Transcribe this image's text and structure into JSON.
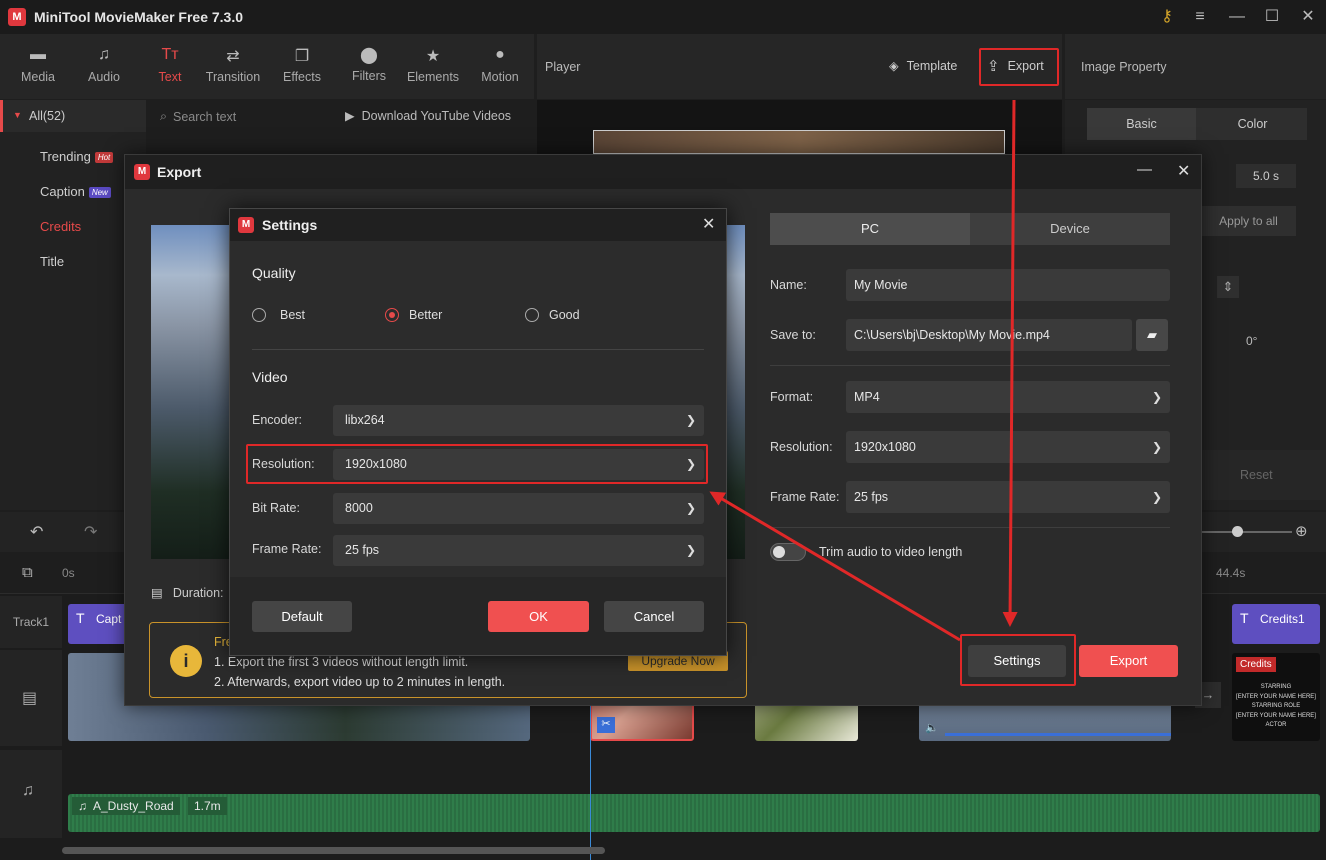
{
  "app": {
    "title": "MiniTool MovieMaker Free 7.3.0",
    "logo": "M"
  },
  "toolbar": {
    "tabs": [
      {
        "label": "Media",
        "icon": "folder-icon"
      },
      {
        "label": "Audio",
        "icon": "music-note-icon"
      },
      {
        "label": "Text",
        "icon": "text-icon"
      },
      {
        "label": "Transition",
        "icon": "transition-icon"
      },
      {
        "label": "Effects",
        "icon": "effects-icon"
      },
      {
        "label": "Filters",
        "icon": "filters-icon"
      },
      {
        "label": "Elements",
        "icon": "elements-icon"
      },
      {
        "label": "Motion",
        "icon": "motion-icon"
      }
    ],
    "active": "Text"
  },
  "player": {
    "label": "Player",
    "template_label": "Template",
    "export_label": "Export"
  },
  "property": {
    "title": "Image Property",
    "tab_basic": "Basic",
    "tab_color": "Color",
    "duration": "5.0 s",
    "apply_all": "Apply to all",
    "rotation": "0°",
    "reset": "Reset"
  },
  "library": {
    "all": "All(52)",
    "search_placeholder": "Search text",
    "download": "Download YouTube Videos",
    "items": [
      {
        "label": "Trending",
        "badge": "Hot"
      },
      {
        "label": "Caption",
        "badge": "New"
      },
      {
        "label": "Credits",
        "badge": ""
      },
      {
        "label": "Title",
        "badge": ""
      }
    ]
  },
  "timeline": {
    "ruler_start": "0s",
    "ruler_end": "44.4s",
    "track1": "Track1",
    "caption_clip": "Capt",
    "credits_clip": "Credits1",
    "credits_tag": "Credits",
    "audio_clip": "A_Dusty_Road",
    "audio_len": "1.7m",
    "credits_lines": [
      "STARRING",
      "[ENTER YOUR NAME HERE]",
      "STARRING ROLE",
      "[ENTER YOUR NAME HERE]",
      "ACTOR"
    ]
  },
  "export": {
    "title": "Export",
    "tab_pc": "PC",
    "tab_device": "Device",
    "name_label": "Name:",
    "name_value": "My Movie",
    "saveto_label": "Save to:",
    "saveto_value": "C:\\Users\\bj\\Desktop\\My Movie.mp4",
    "format_label": "Format:",
    "format_value": "MP4",
    "resolution_label": "Resolution:",
    "resolution_value": "1920x1080",
    "framerate_label": "Frame Rate:",
    "framerate_value": "25 fps",
    "trim_label": "Trim audio to video length",
    "duration_label": "Duration:",
    "notice_title": "Free",
    "notice_line1": "1. Export the first 3 videos without length limit.",
    "notice_line2": "2. Afterwards, export video up to 2 minutes in length.",
    "upgrade": "Upgrade Now",
    "settings_btn": "Settings",
    "export_btn": "Export"
  },
  "settings": {
    "title": "Settings",
    "quality_label": "Quality",
    "quality_options": [
      "Best",
      "Better",
      "Good"
    ],
    "quality_selected": "Better",
    "video_label": "Video",
    "encoder_label": "Encoder:",
    "encoder_value": "libx264",
    "resolution_label": "Resolution:",
    "resolution_value": "1920x1080",
    "bitrate_label": "Bit Rate:",
    "bitrate_value": "8000",
    "framerate_label": "Frame Rate:",
    "framerate_value": "25 fps",
    "default_btn": "Default",
    "ok_btn": "OK",
    "cancel_btn": "Cancel"
  },
  "colors": {
    "accent": "#e64a4a",
    "highlight": "#e02828",
    "warning": "#e8b73a"
  }
}
